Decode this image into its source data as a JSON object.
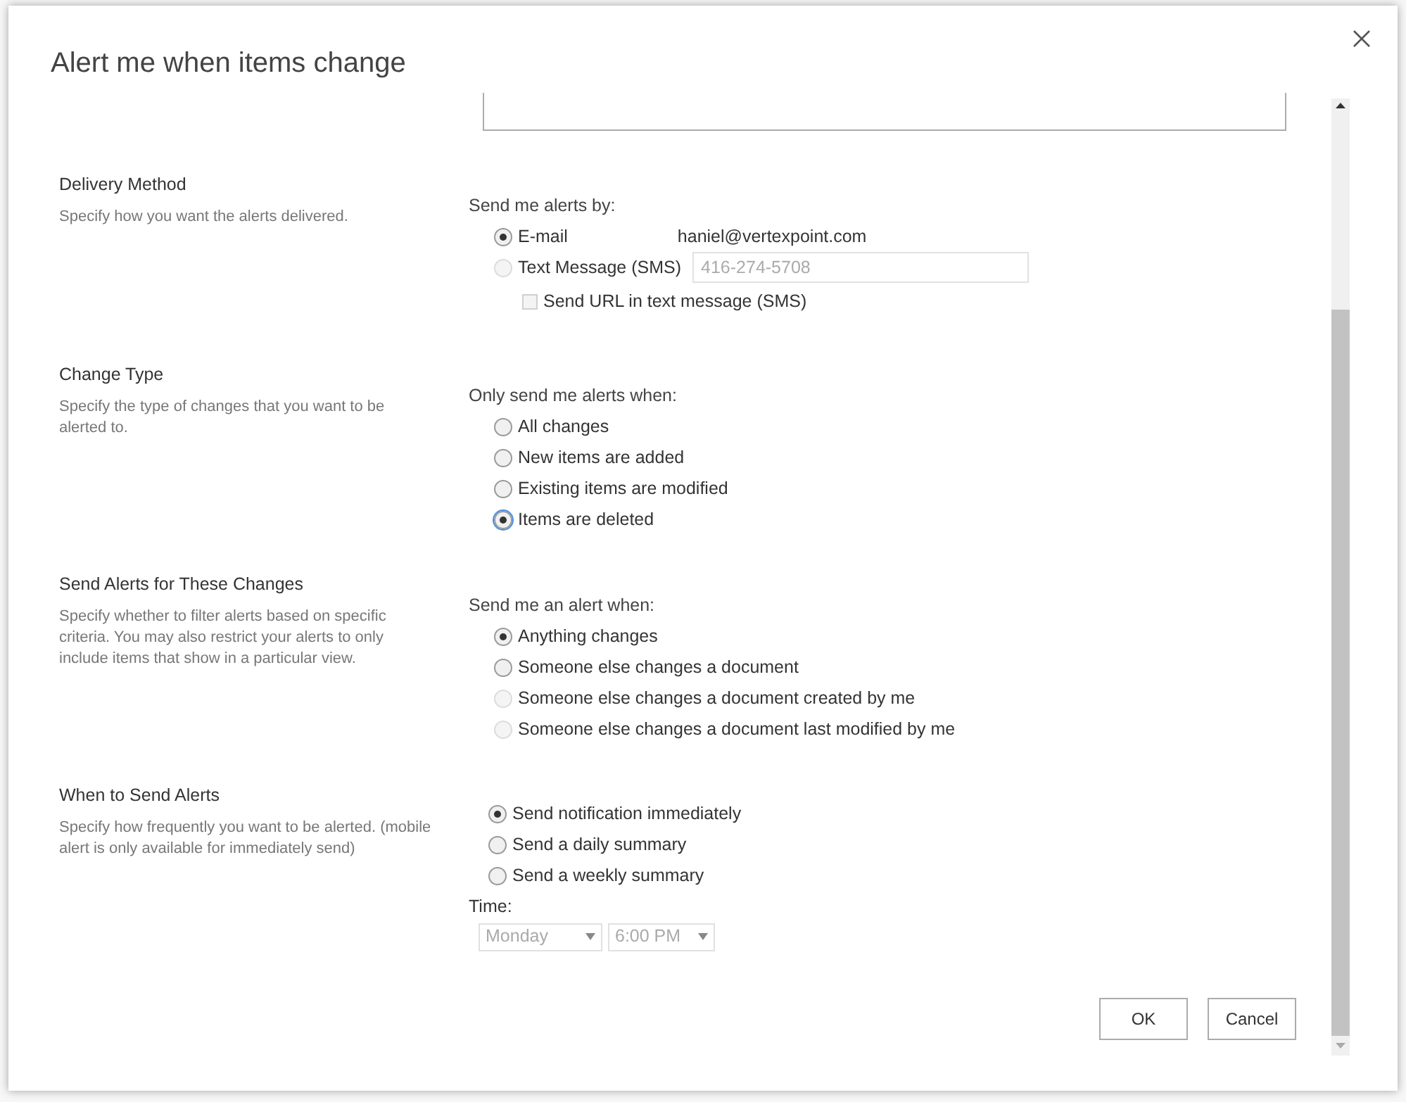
{
  "dialog": {
    "title": "Alert me when items change"
  },
  "delivery_method": {
    "title": "Delivery Method",
    "description": "Specify how you want the alerts delivered.",
    "prompt": "Send me alerts by:",
    "options": [
      {
        "label": "E-mail",
        "selected": true,
        "disabled": false,
        "value": "haniel@vertexpoint.com",
        "kind": "text"
      },
      {
        "label": "Text Message (SMS)",
        "selected": false,
        "disabled": true,
        "value": "416-274-5708",
        "kind": "field"
      }
    ],
    "sms_url": {
      "label": "Send URL in text message (SMS)",
      "checked": false,
      "disabled": true
    }
  },
  "change_type": {
    "title": "Change Type",
    "description": "Specify the type of changes that you want to be alerted to.",
    "prompt": "Only send me alerts when:",
    "options": [
      {
        "label": "All changes",
        "selected": false,
        "disabled": false,
        "focused": false
      },
      {
        "label": "New items are added",
        "selected": false,
        "disabled": false,
        "focused": false
      },
      {
        "label": "Existing items are modified",
        "selected": false,
        "disabled": false,
        "focused": false
      },
      {
        "label": "Items are deleted",
        "selected": true,
        "disabled": false,
        "focused": true
      }
    ]
  },
  "send_alerts_for": {
    "title": "Send Alerts for These Changes",
    "description": "Specify whether to filter alerts based on specific criteria. You may also restrict your alerts to only include items that show in a particular view.",
    "prompt": "Send me an alert when:",
    "options": [
      {
        "label": "Anything changes",
        "selected": true,
        "disabled": false
      },
      {
        "label": "Someone else changes a document",
        "selected": false,
        "disabled": false
      },
      {
        "label": "Someone else changes a document created by me",
        "selected": false,
        "disabled": true
      },
      {
        "label": "Someone else changes a document last modified by me",
        "selected": false,
        "disabled": true
      }
    ]
  },
  "when_to_send": {
    "title": "When to Send Alerts",
    "description": "Specify how frequently you want to be alerted. (mobile alert is only available for immediately send)",
    "options": [
      {
        "label": "Send notification immediately",
        "selected": true,
        "disabled": false
      },
      {
        "label": "Send a daily summary",
        "selected": false,
        "disabled": false
      },
      {
        "label": "Send a weekly summary",
        "selected": false,
        "disabled": false
      }
    ],
    "time_label": "Time:",
    "time_selects": [
      {
        "value": "Monday",
        "disabled": true
      },
      {
        "value": "6:00 PM",
        "disabled": true
      }
    ]
  },
  "buttons": [
    "OK",
    "Cancel"
  ]
}
